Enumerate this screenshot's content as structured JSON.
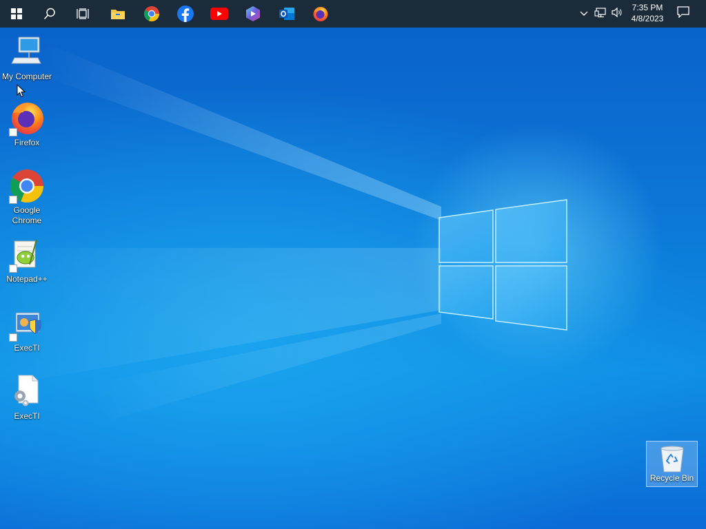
{
  "taskbar": {
    "start": {
      "icon": "windows-start-icon"
    },
    "search": {
      "icon": "search-icon"
    },
    "task_view": {
      "icon": "task-view-icon"
    },
    "pinned": [
      {
        "name": "file-explorer",
        "icon": "folder-icon"
      },
      {
        "name": "google-chrome",
        "icon": "chrome-icon"
      },
      {
        "name": "facebook",
        "icon": "facebook-icon"
      },
      {
        "name": "youtube",
        "icon": "youtube-icon"
      },
      {
        "name": "microsoft-365",
        "icon": "microsoft-365-icon"
      },
      {
        "name": "outlook",
        "icon": "outlook-icon"
      },
      {
        "name": "firefox",
        "icon": "firefox-icon"
      }
    ],
    "tray": {
      "chevron_icon": "chevron-up-icon",
      "network_icon": "network-icon",
      "volume_icon": "volume-icon",
      "time": "7:35 PM",
      "date": "4/8/2023",
      "notification_icon": "action-center-icon"
    },
    "background_color": "#1b2b3a"
  },
  "desktop": {
    "icons": [
      {
        "label": "My Computer",
        "icon": "computer-icon",
        "shortcut": false
      },
      {
        "label": "Firefox",
        "icon": "firefox-icon",
        "shortcut": true
      },
      {
        "label": "Google Chrome",
        "icon": "chrome-icon",
        "shortcut": true
      },
      {
        "label": "Notepad++",
        "icon": "notepad-plus-plus-icon",
        "shortcut": true
      },
      {
        "label": "ExecTI",
        "icon": "exec-ti-shield-icon",
        "shortcut": false
      },
      {
        "label": "ExecTI",
        "icon": "settings-file-icon",
        "shortcut": false
      }
    ],
    "recycle_bin": {
      "label": "Recycle Bin",
      "icon": "recycle-bin-icon",
      "selected": true
    }
  },
  "colors": {
    "wallpaper_primary": "#0a63cf",
    "wallpaper_light": "#1aa3ee",
    "accent_glow": "#78dcff"
  }
}
